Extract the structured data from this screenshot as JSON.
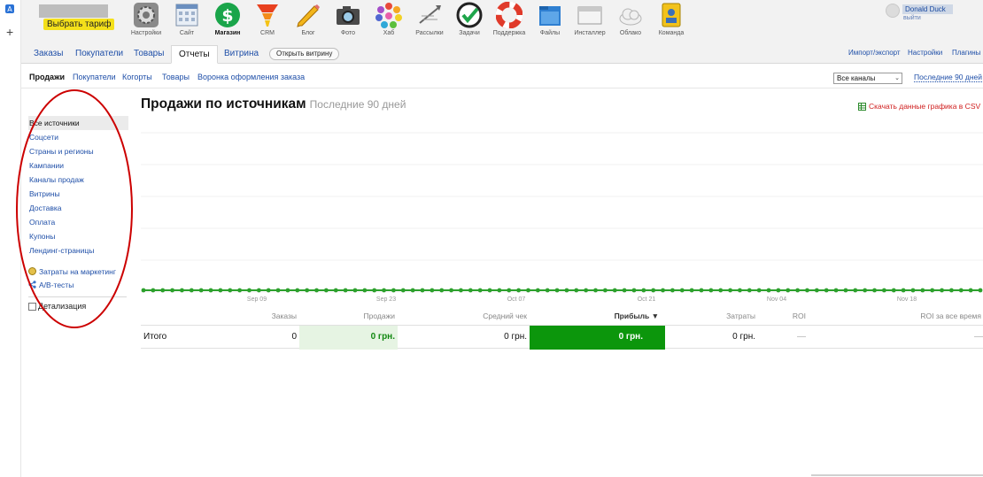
{
  "header": {
    "tariff_label": "Выбрать тариф",
    "apps": [
      {
        "label": "Настройки",
        "icon": "settings-gear-icon"
      },
      {
        "label": "Сайт",
        "icon": "site-calendar-icon"
      },
      {
        "label": "Магазин",
        "icon": "shop-dollar-icon",
        "active": true
      },
      {
        "label": "CRM",
        "icon": "crm-funnel-icon"
      },
      {
        "label": "Блог",
        "icon": "blog-pencil-icon"
      },
      {
        "label": "Фото",
        "icon": "photo-camera-icon"
      },
      {
        "label": "Хаб",
        "icon": "hub-dots-icon"
      },
      {
        "label": "Рассылки",
        "icon": "mailer-icon"
      },
      {
        "label": "Задачи",
        "icon": "tasks-check-icon"
      },
      {
        "label": "Поддержка",
        "icon": "support-lifebuoy-icon"
      },
      {
        "label": "Файлы",
        "icon": "files-folder-icon"
      },
      {
        "label": "Инсталлер",
        "icon": "installer-window-icon"
      },
      {
        "label": "Облако",
        "icon": "cloud-icon"
      },
      {
        "label": "Команда",
        "icon": "team-badge-icon"
      }
    ],
    "user_name": "Donald Duck",
    "logout_label": "выйти"
  },
  "tabs": {
    "items": [
      "Заказы",
      "Покупатели",
      "Товары",
      "Отчеты",
      "Витрина"
    ],
    "active": "Отчеты",
    "open_vitrina": "Открыть витрину",
    "right_links": [
      "Импорт/экспорт",
      "Настройки",
      "Плагины"
    ]
  },
  "subnav": {
    "items": [
      "Продажи",
      "Покупатели",
      "Когорты",
      "Товары",
      "Воронка оформления заказа"
    ],
    "active": "Продажи",
    "channel_select": "Все каналы",
    "period": "Последние 90 дней"
  },
  "sidebar": {
    "items": [
      "Все источники",
      "Соцсети",
      "Страны и регионы",
      "Кампании",
      "Каналы продаж",
      "Витрины",
      "Доставка",
      "Оплата",
      "Купоны",
      "Лендинг-страницы"
    ],
    "active": "Все источники",
    "extras": [
      "Затраты на маркетинг",
      "A/B-тесты"
    ],
    "detail_label": "Детализация"
  },
  "content": {
    "title": "Продажи по источникам",
    "title_hint": "Последние 90 дней",
    "csv_link": "Скачать данные графика в CSV"
  },
  "chart_data": {
    "type": "line",
    "x_tick_labels": [
      "Sep 09",
      "Sep 23",
      "Oct 07",
      "Oct 21",
      "Nov 04",
      "Nov 18"
    ],
    "series": [
      {
        "values_description": "all points zero",
        "value": 0
      }
    ],
    "grid": true,
    "color": "#2ca02c"
  },
  "table": {
    "headers": [
      "Заказы",
      "Продажи",
      "Средний чек",
      "Прибыль ▼",
      "Затраты",
      "ROI",
      "ROI за все время"
    ],
    "row": {
      "label": "Итого",
      "orders": "0",
      "sales": "0 грн.",
      "avg_check": "0 грн.",
      "profit": "0 грн.",
      "costs": "0 грн.",
      "roi": "—",
      "roi_all_time": "—"
    }
  },
  "colors": {
    "link": "#1f4fa8",
    "profit_cell": "#0c960c",
    "sales_cell": "#e6f4e3",
    "annotation": "#cc0000",
    "tariff": "#f4e01a"
  }
}
